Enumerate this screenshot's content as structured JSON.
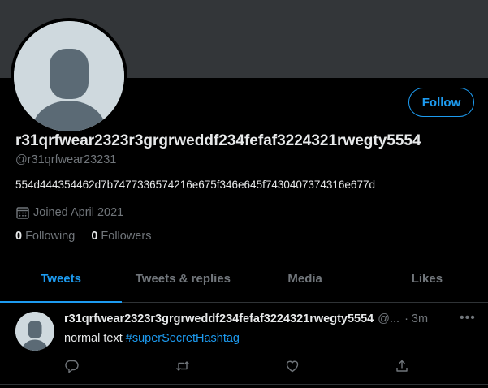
{
  "profile": {
    "display_name": "r31qrfwear2323r3grgrweddf234fefaf3224321rwegty5554",
    "handle": "@r31qrfwear23231",
    "bio": "554d444354462d7b7477336574216e675f346e645f7430407374316e677d",
    "joined": "Joined April 2021",
    "following_count": "0",
    "following_label": "Following",
    "followers_count": "0",
    "followers_label": "Followers",
    "follow_button": "Follow"
  },
  "tabs": [
    {
      "label": "Tweets",
      "active": true
    },
    {
      "label": "Tweets & replies",
      "active": false
    },
    {
      "label": "Media",
      "active": false
    },
    {
      "label": "Likes",
      "active": false
    }
  ],
  "tweet": {
    "name": "r31qrfwear2323r3grgrweddf234fefaf3224321rwegty5554",
    "handle_truncated": "@...",
    "separator": "·",
    "time": "3m",
    "more": "•••",
    "text_plain": "normal text ",
    "hashtag": "#superSecretHashtag"
  },
  "icons": {
    "calendar": "calendar-icon",
    "reply": "reply-icon",
    "retweet": "retweet-icon",
    "like": "heart-icon",
    "share": "share-icon",
    "more": "more-icon"
  },
  "colors": {
    "accent": "#1d9bf0",
    "background": "#000000",
    "banner": "#333639",
    "muted": "#71767b",
    "text": "#e7e9ea"
  }
}
